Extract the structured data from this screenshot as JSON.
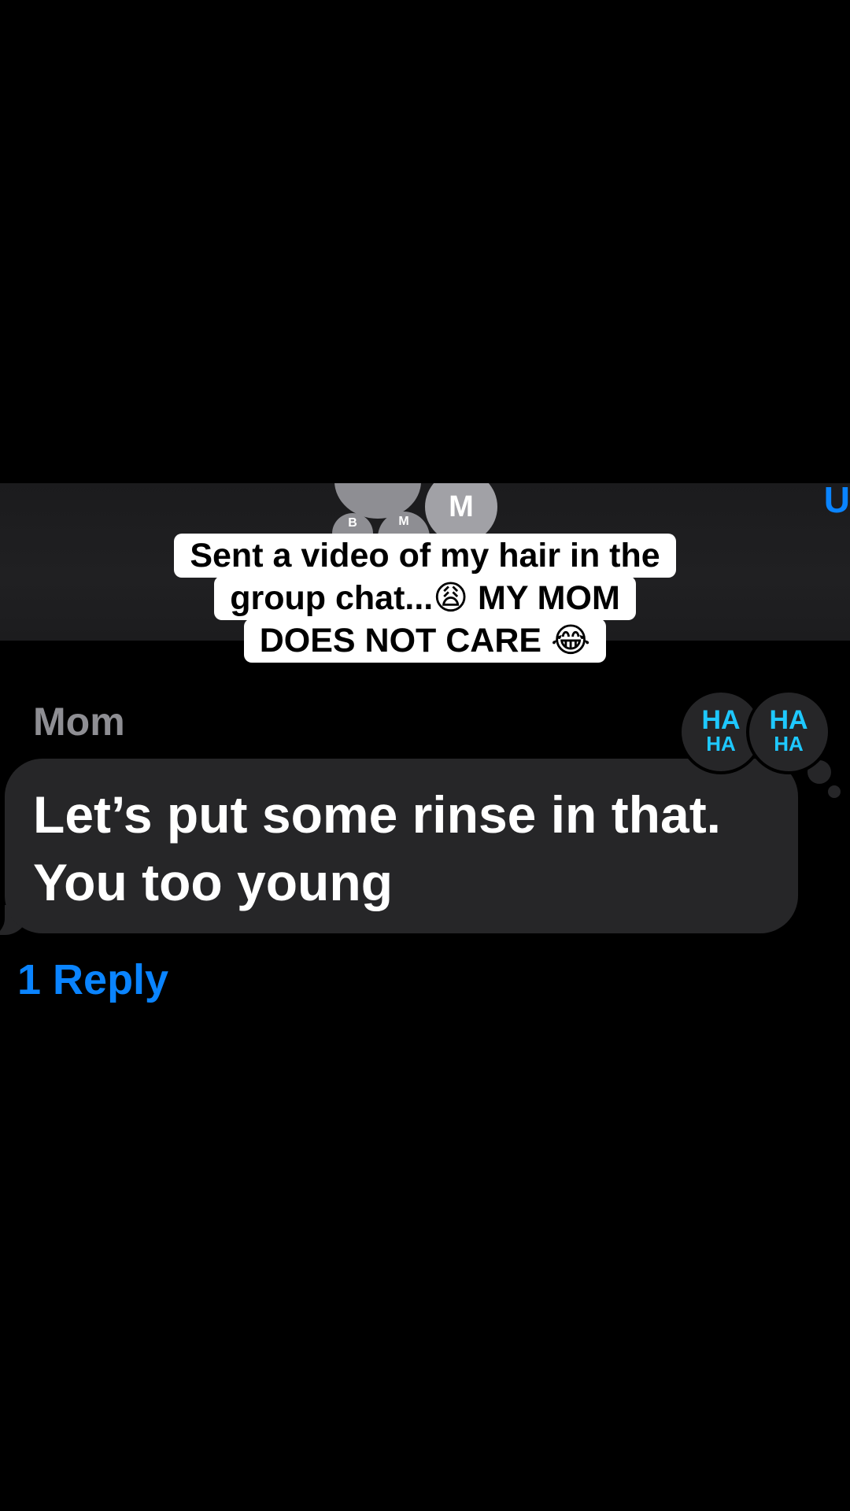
{
  "header": {
    "avatars": [
      {
        "initial": ""
      },
      {
        "initial": "M"
      },
      {
        "initial": "B"
      },
      {
        "initial": "M"
      }
    ],
    "edge_glyph": "U"
  },
  "caption": {
    "line1": "Sent a video of my hair in the",
    "line2": "group chat...😩 MY MOM",
    "line3": "DOES NOT CARE 😂"
  },
  "message": {
    "sender": "Mom",
    "text_line1": "Let’s put some rinse in that.",
    "text_line2": "You too young",
    "reactions": [
      {
        "icon": "haha-reaction-icon",
        "top": "HA",
        "bottom": "HA"
      },
      {
        "icon": "haha-reaction-icon",
        "top": "HA",
        "bottom": "HA"
      }
    ],
    "reply_link": "1 Reply"
  },
  "colors": {
    "background": "#000000",
    "bubble": "#262628",
    "link": "#0a84ff",
    "reaction": "#1ec8ff"
  }
}
